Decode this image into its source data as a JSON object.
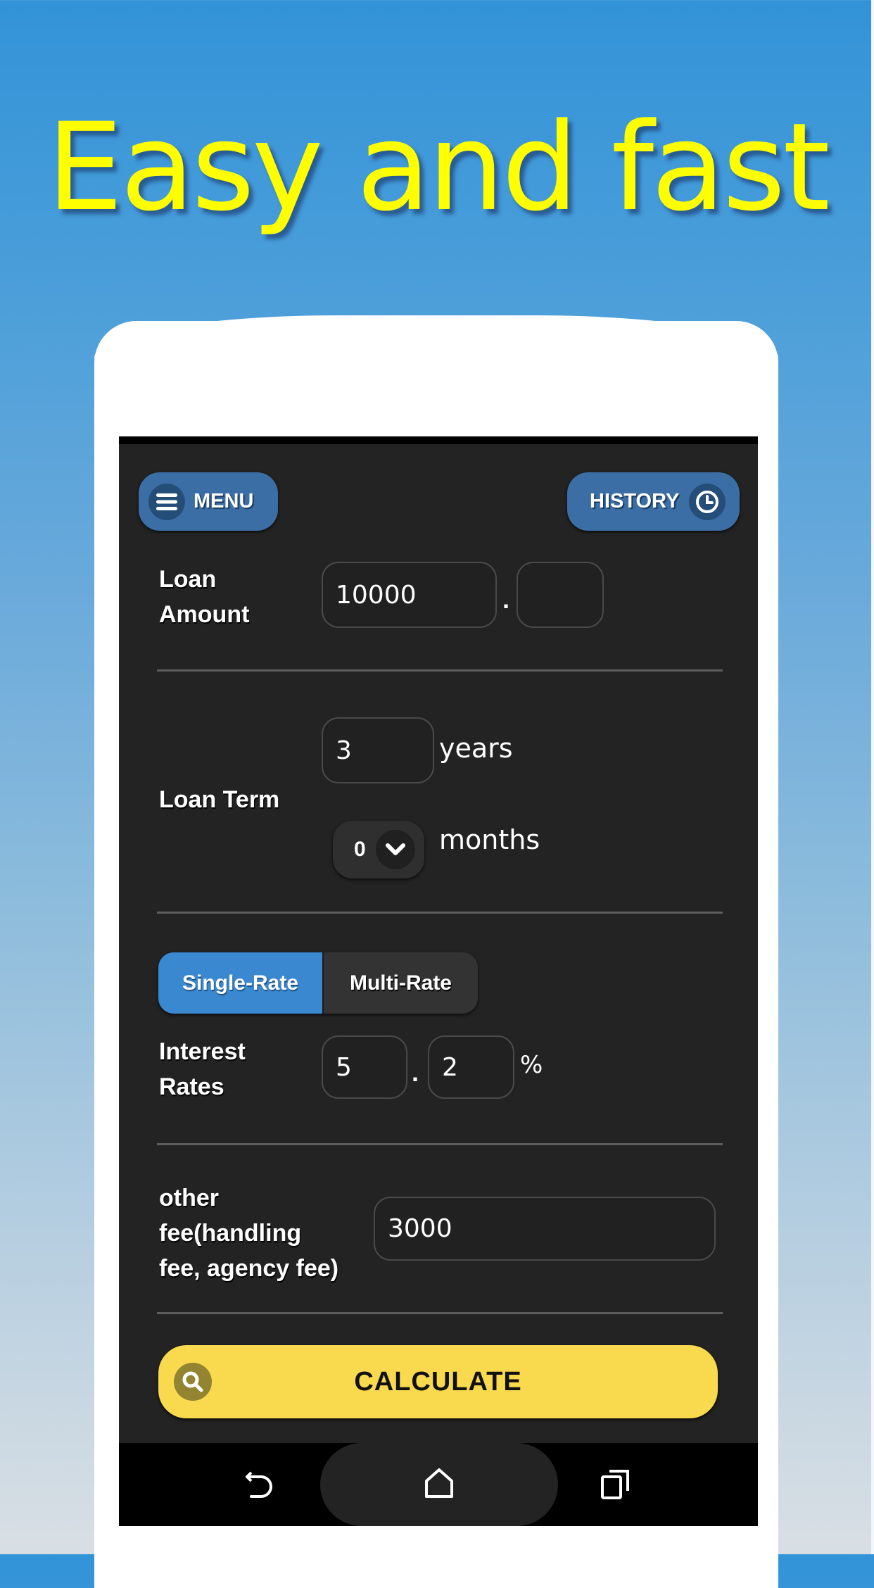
{
  "promo": {
    "headline": "Easy and fast"
  },
  "header": {
    "menu_label": "MENU",
    "history_label": "HISTORY"
  },
  "loan_amount": {
    "label_line1": "Loan",
    "label_line2": "Amount",
    "integer_value": "10000",
    "decimal_separator": ".",
    "decimal_value": ""
  },
  "loan_term": {
    "label": "Loan Term",
    "years_value": "3",
    "years_unit": "years",
    "months_selected": "0",
    "months_unit": "months"
  },
  "rate_tabs": [
    {
      "label": "Single-Rate",
      "active": true
    },
    {
      "label": "Multi-Rate",
      "active": false
    }
  ],
  "interest": {
    "label_line1": "Interest",
    "label_line2": "Rates",
    "integer_value": "5",
    "decimal_separator": ".",
    "decimal_value": "2",
    "unit": "%"
  },
  "other_fee": {
    "label_line1": "other",
    "label_line2": "fee(handling",
    "label_line3": "fee, agency fee)",
    "value": "3000"
  },
  "calculate": {
    "label": "CALCULATE"
  },
  "colors": {
    "headline": "#ffff00",
    "header_button": "#3c6ea6",
    "active_tab": "#3a88cf",
    "calculate_button": "#f9d94d",
    "screen_background": "#232323"
  },
  "system_nav": {
    "icons": [
      "back-icon",
      "home-icon",
      "recent-apps-icon"
    ]
  }
}
